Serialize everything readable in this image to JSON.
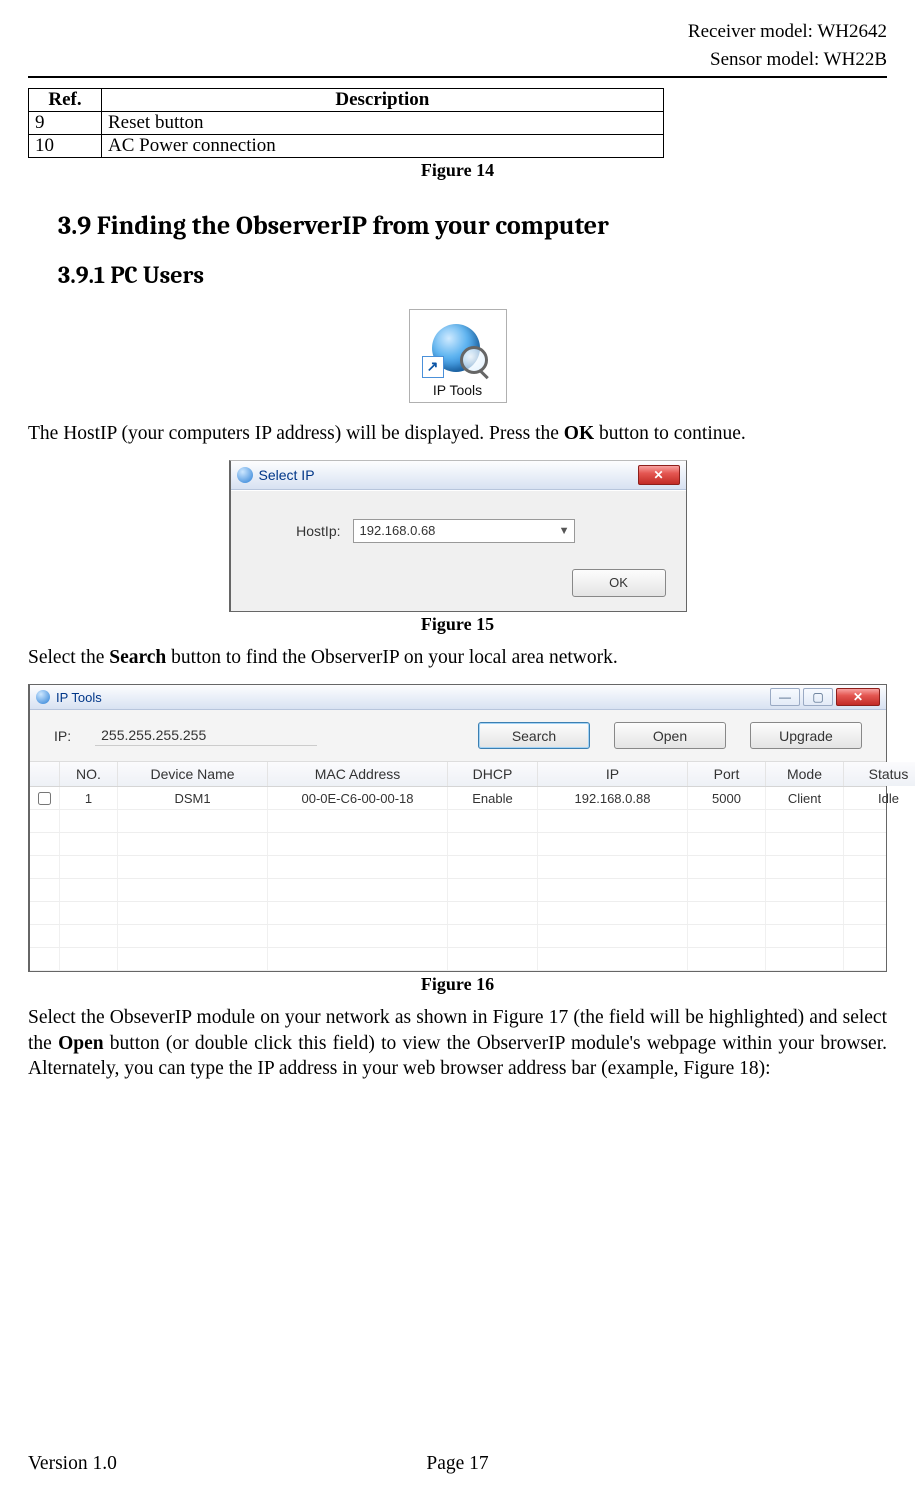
{
  "header": {
    "receiver_model": "Receiver model: WH2642",
    "sensor_model": "Sensor model: WH22B"
  },
  "ref_table": {
    "headers": {
      "ref": "Ref.",
      "desc": "Description"
    },
    "rows": [
      {
        "ref": "9",
        "desc": "Reset button"
      },
      {
        "ref": "10",
        "desc": "AC Power connection"
      }
    ]
  },
  "captions": {
    "fig14": "Figure 14",
    "fig15": "Figure 15",
    "fig16": "Figure 16"
  },
  "headings": {
    "section": "3.9 Finding the ObserverIP from your computer",
    "subsection": "3.9.1  PC Users"
  },
  "iptools_icon": {
    "label": "IP Tools"
  },
  "paragraphs": {
    "p1_pre": "The HostIP (your computers IP address) will be displayed.    Press the ",
    "p1_bold": "OK",
    "p1_post": " button to continue.",
    "p2_pre": "Select the ",
    "p2_bold": "Search",
    "p2_post": " button to find the ObserverIP on your local area network.",
    "p3_pre": "Select the ObseverIP module on your network as shown in Figure 17    (the field will be highlighted) and select the ",
    "p3_bold": "Open",
    "p3_post": " button (or double click this field) to view the ObserverIP module's webpage within your browser. Alternately, you can type the IP address in your web browser address bar (example, Figure 18):"
  },
  "select_ip": {
    "title": "Select IP",
    "host_label": "HostIp:",
    "host_value": "192.168.0.68",
    "ok_label": "OK",
    "close_glyph": "✕"
  },
  "iptools_window": {
    "title": "IP Tools",
    "ip_label": "IP:",
    "ip_value": "255.255.255.255",
    "search_label": "Search",
    "open_label": "Open",
    "upgrade_label": "Upgrade",
    "close_glyph": "✕",
    "columns": [
      "",
      "NO.",
      "Device Name",
      "MAC Address",
      "DHCP",
      "IP",
      "Port",
      "Mode",
      "Status"
    ],
    "rows": [
      {
        "no": "1",
        "device": "DSM1",
        "mac": "00-0E-C6-00-00-18",
        "dhcp": "Enable",
        "ip": "192.168.0.88",
        "port": "5000",
        "mode": "Client",
        "status": "Idle"
      }
    ]
  },
  "footer": {
    "version": "Version 1.0",
    "page": "Page 17"
  }
}
